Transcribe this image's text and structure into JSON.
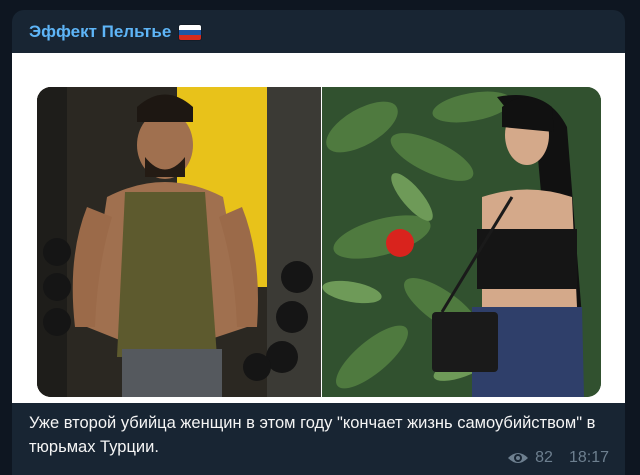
{
  "channel": {
    "title": "Эффект Пельтье",
    "flag_icon": "russia-flag-icon"
  },
  "post": {
    "caption": "Уже второй убийца женщин в этом году \"кончает жизнь самоубийством\" в тюрьмах Турции.",
    "views": "82",
    "time": "18:17"
  },
  "colors": {
    "background": "#0e1621",
    "bubble": "#182533",
    "title": "#5eb5f7",
    "meta": "#6d7f8f"
  }
}
